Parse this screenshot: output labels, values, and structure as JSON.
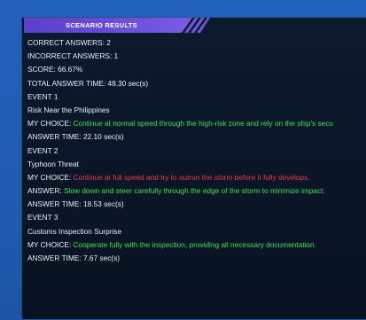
{
  "header": {
    "title": "SCENARIO RESULTS"
  },
  "summary": {
    "correct": "CORRECT ANSWERS: 2",
    "incorrect": "INCORRECT ANSWERS: 1",
    "score": "SCORE: 66.67%",
    "total_time": "TOTAL ANSWER TIME: 48.30 sec(s)"
  },
  "events": [
    {
      "event_label": "EVENT 1",
      "title": "Risk Near the Philippines",
      "choice_label": "MY CHOICE: ",
      "choice_text": "Continue at normal speed through the high-risk zone and rely on the ship's secu",
      "answer_time": "ANSWER TIME: 22.10 sec(s)"
    },
    {
      "event_label": "EVENT 2",
      "title": "Typhoon Threat",
      "choice_label": "MY CHOICE: ",
      "choice_text": "Continue at full speed and try to outrun the storm before it fully develops.",
      "answer_label": "ANSWER: ",
      "answer_text": "Slow down and steer carefully through the edge of the storm to minimize impact.",
      "answer_time": "ANSWER TIME: 18.53 sec(s)"
    },
    {
      "event_label": "EVENT 3",
      "title": "Customs Inspection Surprise",
      "choice_label": "MY CHOICE: ",
      "choice_text": "Cooperate fully with the inspection, providing all necessary documentation.",
      "answer_time": "ANSWER TIME: 7.67 sec(s)"
    }
  ],
  "colors": {
    "correct": "#39e05a",
    "incorrect": "#e8384a",
    "header": "#6a4fd6"
  }
}
